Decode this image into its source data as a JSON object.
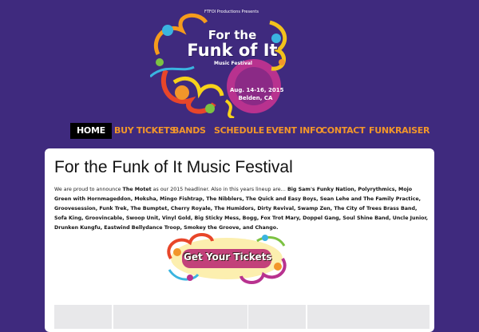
{
  "header": {
    "presents": "FTFOI Productions Presents",
    "title_line1": "For the",
    "title_line2": "Funk of It",
    "subtitle": "Music Festival",
    "dates": "Aug. 14-16, 2015",
    "location": "Belden, CA"
  },
  "nav": {
    "items": [
      {
        "label": "HOME",
        "active": true
      },
      {
        "label": "BUY TICKETS"
      },
      {
        "label": "BANDS"
      },
      {
        "label": "SCHEDULE"
      },
      {
        "label": "EVENT INFO"
      },
      {
        "label": "CONTACT"
      },
      {
        "label": "FUNKRAISER"
      }
    ]
  },
  "main": {
    "title": "For the Funk of It Music Festival",
    "intro_before": "We are proud to announce ",
    "headliner": "The Motet",
    "intro_middle": " as our 2015 headliner. Also in this years lineup are…  ",
    "lineup": "Big Sam's Funky Nation, Polyrythmics, Mojo Green with Hornmageddon, Moksha, Mingo Fishtrap, The Nibblers, The Quick and Easy Boys, Sean Lehe and The Family Practice, Groovesession, Funk Trek, The Bumptet, Cherry Royale, The Humidors, Dirty Revival, Swamp Zen, The City of Trees Brass Band, Sofa King, Groovincable, Swoop Unit, Vinyl Gold, Big Sticky Mess, Bogg, Fox Trot Mary, Doppel Gang, Soul Shine Band, Uncle Junior, Drunken Kungfu, Eastwind Bellydance Troop, Smokey the Groove, and Chango.",
    "tickets_banner": "Get Your Tickets"
  },
  "colors": {
    "background": "#3f2a7e",
    "nav_text": "#f2962a",
    "nav_active_bg": "#000000",
    "content_bg": "#ffffff"
  }
}
